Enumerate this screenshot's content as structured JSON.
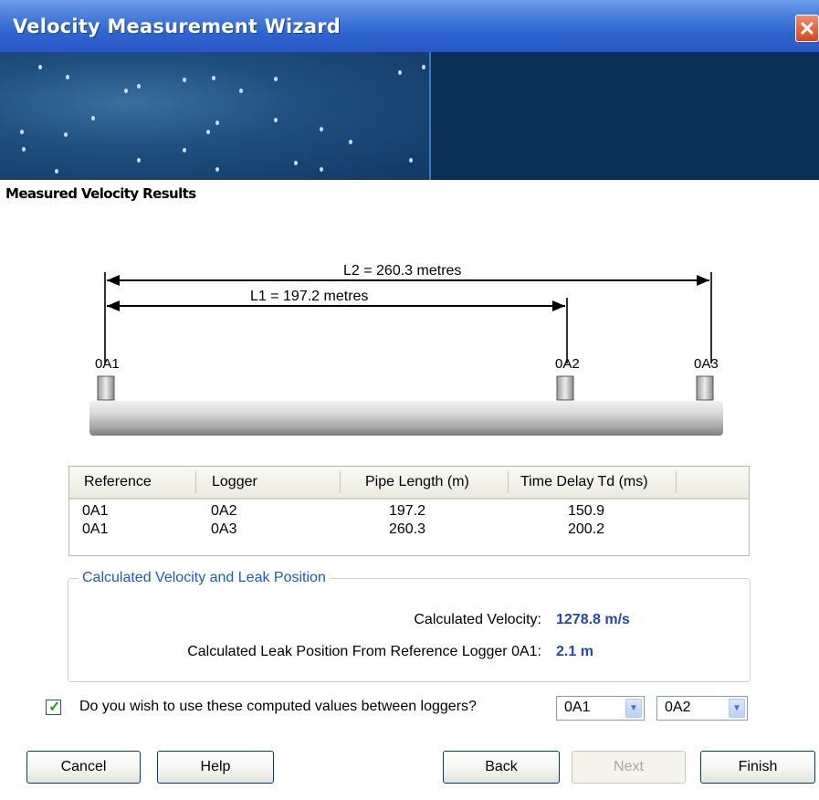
{
  "window": {
    "title": "Velocity Measurement Wizard"
  },
  "section_heading": "Measured Velocity Results",
  "diagram": {
    "l2_label": "L2 = 260.3 metres",
    "l1_label": "L1 = 197.2 metres",
    "loggers": [
      "0A1",
      "0A2",
      "0A3"
    ]
  },
  "table": {
    "headers": [
      "Reference",
      "Logger",
      "Pipe Length (m)",
      "Time Delay Td (ms)"
    ],
    "rows": [
      [
        "0A1",
        "0A2",
        "197.2",
        "150.9"
      ],
      [
        "0A1",
        "0A3",
        "260.3",
        "200.2"
      ]
    ]
  },
  "calculated": {
    "group_label": "Calculated Velocity and Leak Position",
    "velocity_label": "Calculated Velocity:",
    "velocity_value": "1278.8 m/s",
    "leak_label": "Calculated Leak Position From Reference Logger 0A1:",
    "leak_value": "2.1 m"
  },
  "use_values": {
    "checked": true,
    "label": "Do you wish to use these computed values between loggers?",
    "logger_a": "0A1",
    "logger_b": "0A2"
  },
  "buttons": {
    "cancel": "Cancel",
    "help": "Help",
    "back": "Back",
    "next": "Next",
    "finish": "Finish"
  },
  "colors": {
    "titlebar": "#2e63cf",
    "accent_text": "#2448a8",
    "group_label": "#1d5ab8"
  }
}
